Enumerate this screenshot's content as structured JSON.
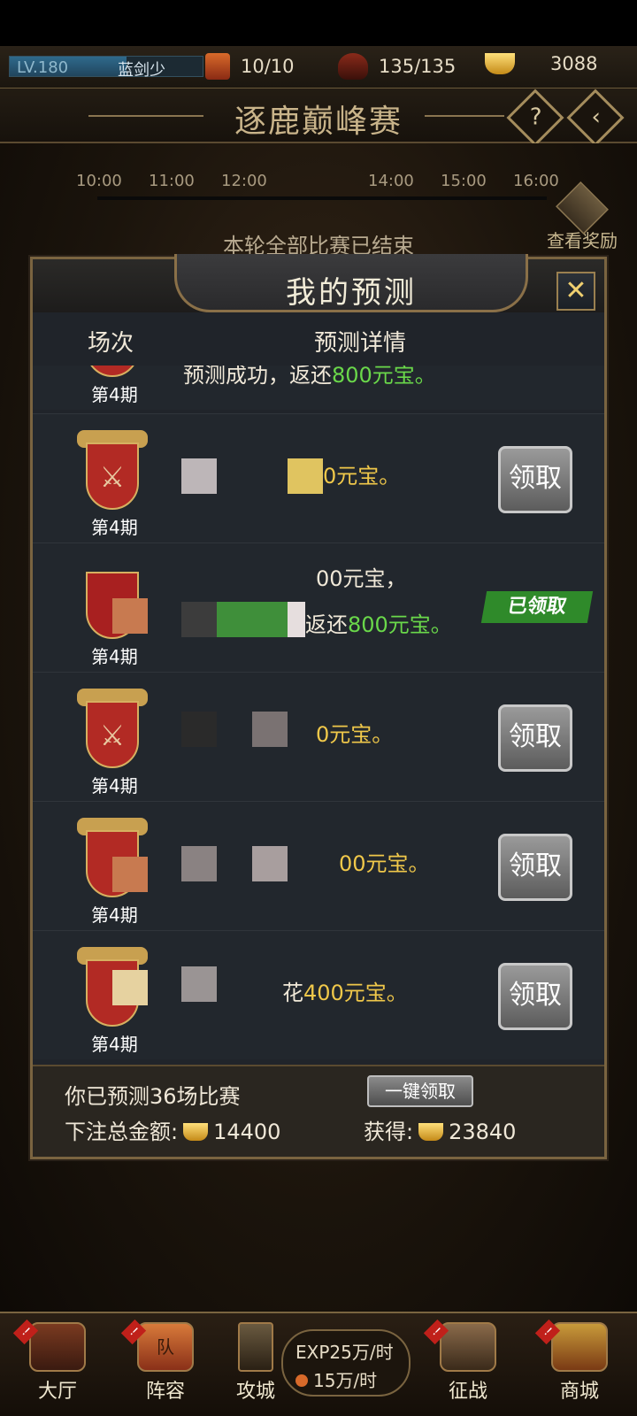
{
  "topbar": {
    "level": "LV.180",
    "player_name": "蓝剑少",
    "tickets": "10/10",
    "stamina": "135/135",
    "ingots": "3088"
  },
  "event": {
    "title": "逐鹿巅峰赛",
    "help_icon": "question-icon",
    "back_icon": "diamond-back-icon",
    "times": [
      "10:00",
      "11:00",
      "12:00",
      "14:00",
      "15:00",
      "16:00"
    ],
    "status": "本轮全部比赛已结束",
    "view_reward": "查看奖励"
  },
  "dialog": {
    "title": "我的预测",
    "close_icon": "close-icon",
    "col_match": "场次",
    "col_detail": "预测详情",
    "rows": [
      {
        "period": "第4期",
        "line1": "预测成功，返还",
        "gold": "800元宝。",
        "state": "partial"
      },
      {
        "period": "第4期",
        "text_prefix": "",
        "gold": "0元宝。",
        "state": "claim",
        "button": "领取"
      },
      {
        "period": "第4期",
        "line1": "00元宝，",
        "line2_prefix": "返还",
        "green": "800元宝。",
        "state": "claimed",
        "badge": "已领取"
      },
      {
        "period": "第4期",
        "gold": "0元宝。",
        "state": "claim",
        "button": "领取"
      },
      {
        "period": "第4期",
        "gold": "00元宝。",
        "state": "claim",
        "button": "领取"
      },
      {
        "period": "第4期",
        "text_prefix": "花",
        "gold": "400元宝。",
        "state": "claim",
        "button": "领取"
      }
    ],
    "footer": {
      "predicted": "你已预测36场比赛",
      "onekey": "一键领取",
      "total_label": "下注总金额:",
      "total_value": "14400",
      "gain_label": "获得:",
      "gain_value": "23840"
    }
  },
  "nav": {
    "hall": "大厅",
    "team": "阵容",
    "siege": "攻城",
    "exp": "EXP25万/时",
    "coin": "15万/时",
    "campaign": "征战",
    "shop": "商城",
    "team_badge": "队"
  }
}
